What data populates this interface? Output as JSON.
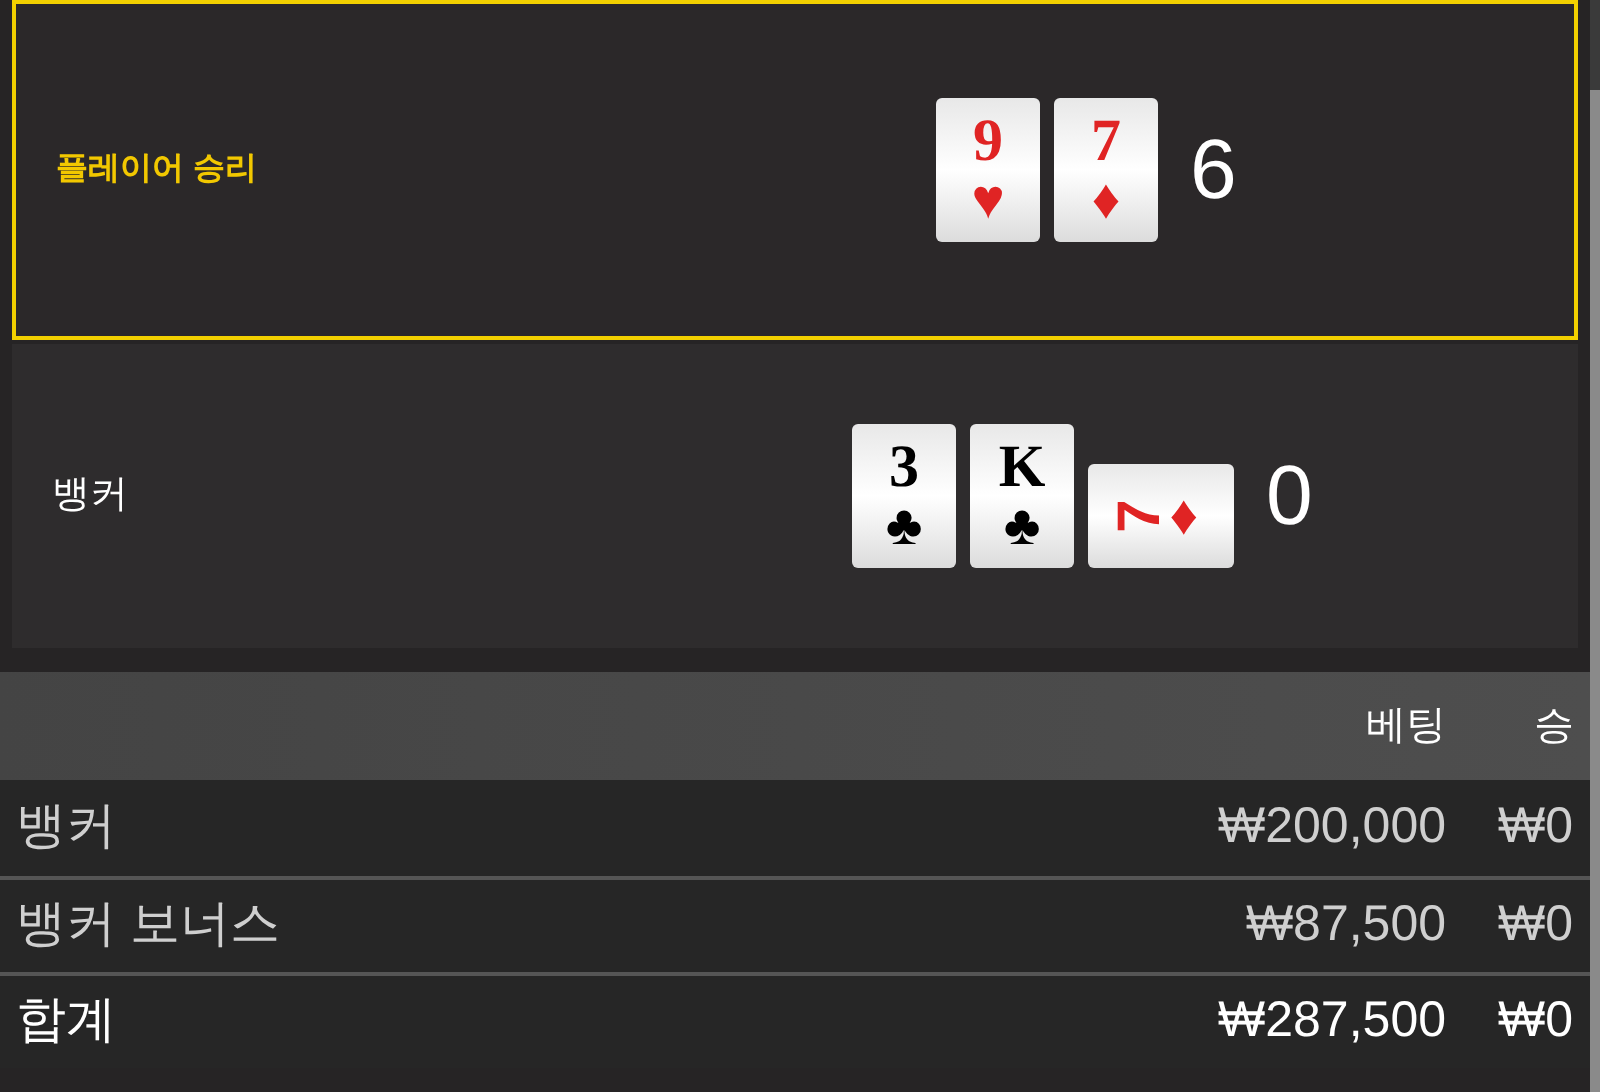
{
  "hands": [
    {
      "label": "플레이어 승리",
      "selected": true,
      "score": "6",
      "cards": [
        {
          "rank": "9",
          "suit": "♥",
          "color": "#e02424",
          "sideways": false
        },
        {
          "rank": "7",
          "suit": "♦",
          "color": "#e02424",
          "sideways": false
        }
      ]
    },
    {
      "label": "뱅커",
      "selected": false,
      "score": "0",
      "cards": [
        {
          "rank": "3",
          "suit": "♣",
          "color": "#000000",
          "sideways": false
        },
        {
          "rank": "K",
          "suit": "♣",
          "color": "#000000",
          "sideways": false
        },
        {
          "rank": "7",
          "suit": "♦",
          "color": "#e02424",
          "sideways": true
        }
      ]
    }
  ],
  "table": {
    "columns": [
      "베팅",
      "승"
    ],
    "rows": [
      {
        "kind": "bet",
        "name": "뱅커",
        "bet": "₩200,000",
        "win": "₩0"
      },
      {
        "kind": "bet",
        "name": "뱅커 보너스",
        "bet": "₩87,500",
        "win": "₩0"
      },
      {
        "kind": "total",
        "name": "합계",
        "bet": "₩287,500",
        "win": "₩0"
      }
    ]
  }
}
